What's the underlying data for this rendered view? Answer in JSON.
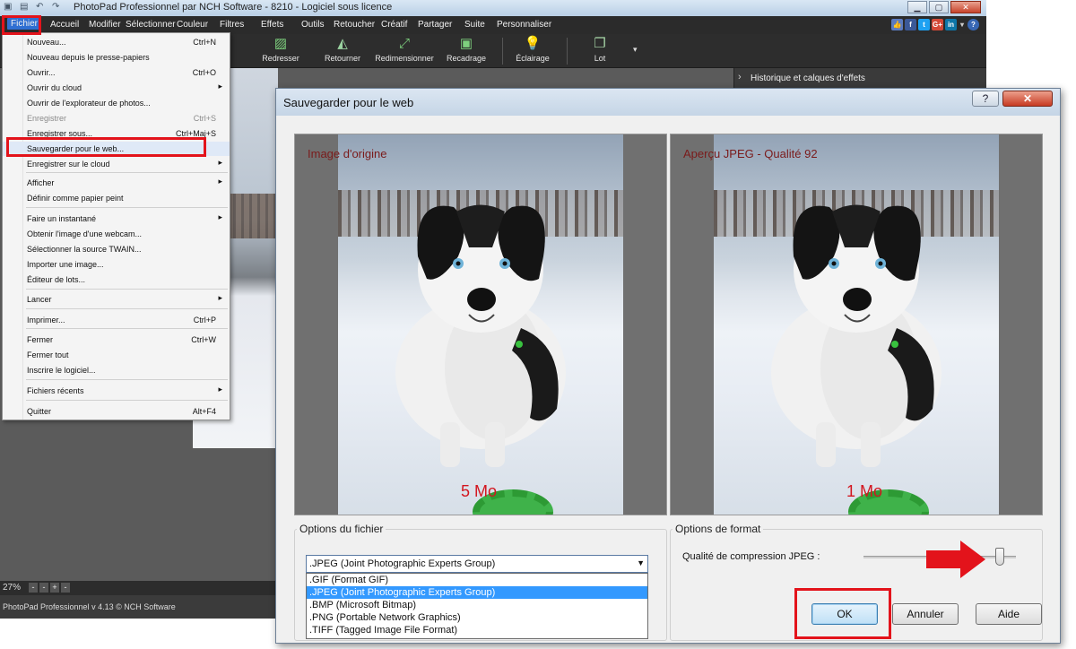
{
  "app": {
    "title": "PhotoPad Professionnel par NCH Software - 8210 - Logiciel sous licence",
    "menus": [
      {
        "label": "Fichier"
      },
      {
        "label": "Accueil"
      },
      {
        "label": "Modifier"
      },
      {
        "label": "Sélectionner"
      },
      {
        "label": "Couleur"
      },
      {
        "label": "Filtres"
      },
      {
        "label": "Effets"
      },
      {
        "label": "Outils"
      },
      {
        "label": "Retoucher"
      },
      {
        "label": "Créatif"
      },
      {
        "label": "Partager"
      },
      {
        "label": "Suite"
      },
      {
        "label": "Personnaliser"
      }
    ],
    "toolbar": [
      {
        "label": "Redresser",
        "icon": "straighten-icon"
      },
      {
        "label": "Retourner",
        "icon": "flip-icon"
      },
      {
        "label": "Redimensionner",
        "icon": "resize-icon"
      },
      {
        "label": "Recadrage",
        "icon": "crop-icon"
      },
      {
        "label": "Éclairage",
        "icon": "lighting-icon"
      },
      {
        "label": "Lot",
        "icon": "batch-icon"
      }
    ],
    "history_panel": "Historique et calques d'effets",
    "zoom": "27%",
    "zoom_buttons": [
      "-",
      "-",
      "+",
      "-"
    ],
    "status": "PhotoPad Professionnel v 4.13 © NCH Software",
    "socials": [
      {
        "label": "👍",
        "color": "#5b7bc0"
      },
      {
        "label": "f",
        "color": "#3b5998"
      },
      {
        "label": "t",
        "color": "#1da1f2"
      },
      {
        "label": "G+",
        "color": "#d34836"
      },
      {
        "label": "in",
        "color": "#0e76a8"
      }
    ]
  },
  "file_menu": {
    "items": [
      {
        "label": "Nouveau...",
        "shortcut": "Ctrl+N"
      },
      {
        "label": "Nouveau depuis le presse-papiers",
        "shortcut": ""
      },
      {
        "label": "Ouvrir...",
        "shortcut": "Ctrl+O"
      },
      {
        "label": "Ouvrir du cloud",
        "shortcut": "",
        "submenu": true
      },
      {
        "label": "Ouvrir de l'explorateur de photos...",
        "shortcut": ""
      },
      {
        "label": "Enregistrer",
        "shortcut": "Ctrl+S",
        "disabled": true
      },
      {
        "label": "Enregistrer sous...",
        "shortcut": "Ctrl+Maj+S"
      },
      {
        "label": "Sauvegarder pour le web...",
        "shortcut": "",
        "highlighted": true
      },
      {
        "label": "Enregistrer sur le cloud",
        "shortcut": "",
        "submenu": true
      },
      {
        "label": "Afficher",
        "shortcut": "",
        "submenu": true
      },
      {
        "label": "Définir comme papier peint",
        "shortcut": ""
      },
      {
        "label": "Faire un instantané",
        "shortcut": "",
        "submenu": true
      },
      {
        "label": "Obtenir l'image d'une webcam...",
        "shortcut": ""
      },
      {
        "label": "Sélectionner la source TWAIN...",
        "shortcut": ""
      },
      {
        "label": "Importer une image...",
        "shortcut": ""
      },
      {
        "label": "Éditeur de lots...",
        "shortcut": ""
      },
      {
        "label": "Lancer",
        "shortcut": "",
        "submenu": true
      },
      {
        "label": "Imprimer...",
        "shortcut": "Ctrl+P"
      },
      {
        "label": "Fermer",
        "shortcut": "Ctrl+W"
      },
      {
        "label": "Fermer tout",
        "shortcut": ""
      },
      {
        "label": "Inscrire le logiciel...",
        "shortcut": ""
      },
      {
        "label": "Fichiers récents",
        "shortcut": "",
        "submenu": true
      },
      {
        "label": "Quitter",
        "shortcut": "Alt+F4"
      }
    ]
  },
  "dialog": {
    "title": "Sauvegarder pour le web",
    "help": "?",
    "close": "✕",
    "original": {
      "caption": "Image d'origine",
      "size": "5 Mo"
    },
    "preview": {
      "caption": "Aperçu JPEG - Qualité 92",
      "size": "1 Mo"
    },
    "file_options": {
      "legend": "Options du fichier",
      "selected": ".JPEG (Joint Photographic Experts Group)",
      "options": [
        ".GIF (Format GIF)",
        ".JPEG (Joint Photographic Experts Group)",
        ".BMP (Microsoft Bitmap)",
        ".PNG (Portable Network Graphics)",
        ".TIFF (Tagged Image File Format)"
      ]
    },
    "format_options": {
      "legend": "Options de format",
      "quality_label": "Qualité de compression JPEG :",
      "quality": 92
    },
    "buttons": {
      "ok": "OK",
      "cancel": "Annuler",
      "help": "Aide"
    }
  }
}
